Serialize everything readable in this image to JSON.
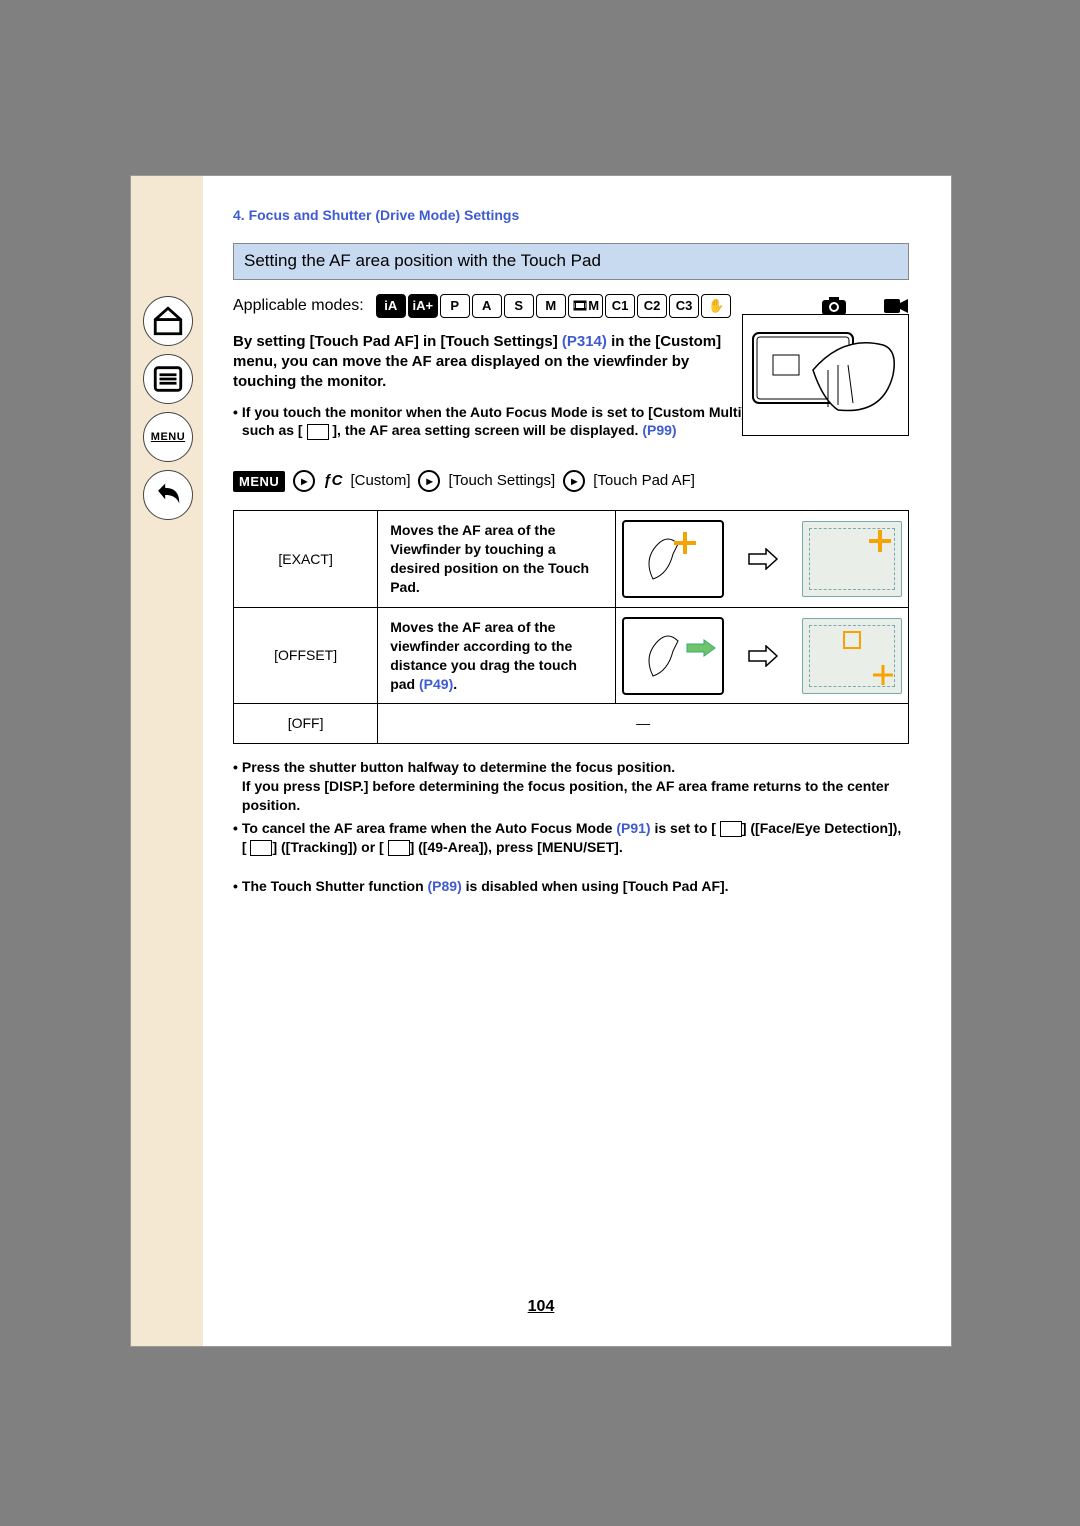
{
  "sidebar": {
    "menu_label": "MENU"
  },
  "header": {
    "chapter": "4. Focus and Shutter (Drive Mode) Settings"
  },
  "section": {
    "title": "Setting the AF area position with the Touch Pad"
  },
  "modes": {
    "label": "Applicable modes:",
    "list": [
      "iA",
      "iA+",
      "P",
      "A",
      "S",
      "M",
      "🎞M",
      "C1",
      "C2",
      "C3",
      "✋"
    ]
  },
  "intro": {
    "pre": "By setting [Touch Pad AF] in [Touch Settings] ",
    "link1": "(P314)",
    "post": " in the [Custom] menu, you can move the AF area displayed on the viewfinder by touching the monitor."
  },
  "note1": {
    "line1": "If you touch the monitor when the Auto Focus Mode is set to [Custom Multi] such as [",
    "icon_name": "multi-area-icon",
    "line2": "], the AF area setting screen will be displayed. ",
    "link": "(P99)"
  },
  "menu_path": {
    "menu": "MENU",
    "fc": "ƒC",
    "items": [
      "[Custom]",
      "[Touch Settings]",
      "[Touch Pad AF]"
    ]
  },
  "table": {
    "rows": [
      {
        "label": "[EXACT]",
        "desc": "Moves the AF area of the Viewfinder by touching a desired position on the Touch Pad."
      },
      {
        "label": "[OFFSET]",
        "desc_pre": "Moves the AF area of the viewfinder according to the distance you drag the touch pad ",
        "link": "(P49)",
        "desc_post": "."
      },
      {
        "label": "[OFF]",
        "dash": "—"
      }
    ]
  },
  "after": {
    "b1": "Press the shutter button halfway to determine the focus position.",
    "b1b": "If you press [DISP.] before determining the focus position, the AF area frame returns to the center position.",
    "b2_pre": "To cancel the AF area frame when the Auto Focus Mode ",
    "b2_link1": "(P91)",
    "b2_mid": " is set to [",
    "b2_mid2": "] ([Face/Eye Detection]), [",
    "b2_mid3": "] ([Tracking]) or [",
    "b2_mid4": "] ([49-Area]), press [MENU/SET].",
    "b3_pre": "The Touch Shutter function ",
    "b3_link": "(P89)",
    "b3_post": " is disabled when using [Touch Pad AF]."
  },
  "page_number": "104"
}
